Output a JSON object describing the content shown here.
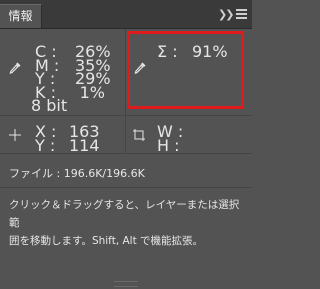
{
  "tab": {
    "label": "情報"
  },
  "header_icons": {
    "collapse": "collapse-panel-icon",
    "menu": "panel-menu-icon"
  },
  "cmyk": {
    "c_label": "C :",
    "c_value": "26%",
    "m_label": "M :",
    "m_value": "35%",
    "y_label": "Y :",
    "y_value": "29%",
    "k_label": "K :",
    "k_value": "1%",
    "bitdepth": "8 bit",
    "icon": "eyedropper-icon"
  },
  "sigma": {
    "label": "Σ :",
    "value": "91%",
    "icon": "eyedropper-icon",
    "highlight_color": "#e01b1b"
  },
  "position": {
    "x_label": "X :",
    "x_value": "163",
    "y_label": "Y :",
    "y_value": "114",
    "icon": "crosshair-icon"
  },
  "size": {
    "w_label": "W :",
    "w_value": "",
    "h_label": "H :",
    "h_value": "",
    "icon": "selection-size-icon"
  },
  "file": {
    "text": "ファイル : 196.6K/196.6K"
  },
  "hint": {
    "line1": "クリック＆ドラッグすると、レイヤーまたは選択範",
    "line2": "囲を移動します。Shift, Alt で機能拡張。"
  }
}
